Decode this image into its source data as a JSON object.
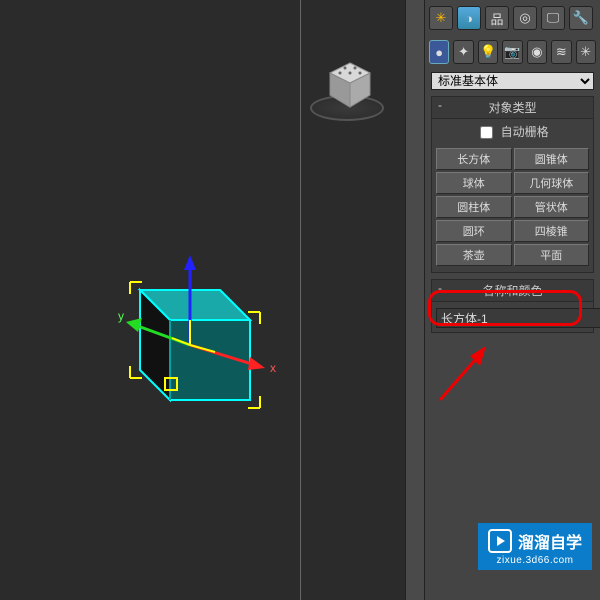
{
  "dropdown": {
    "selected": "标准基本体"
  },
  "rollout1": {
    "title": "对象类型",
    "autogrid_label": "自动栅格",
    "buttons": [
      "长方体",
      "圆锥体",
      "球体",
      "几何球体",
      "圆柱体",
      "管状体",
      "圆环",
      "四棱锥",
      "茶壶",
      "平面"
    ]
  },
  "rollout2": {
    "title": "名称和颜色",
    "name_value": "长方体-1"
  },
  "axes": {
    "x": "x",
    "y": "y"
  },
  "watermark": {
    "brand": "溜溜自学",
    "url": "zixue.3d66.com"
  }
}
